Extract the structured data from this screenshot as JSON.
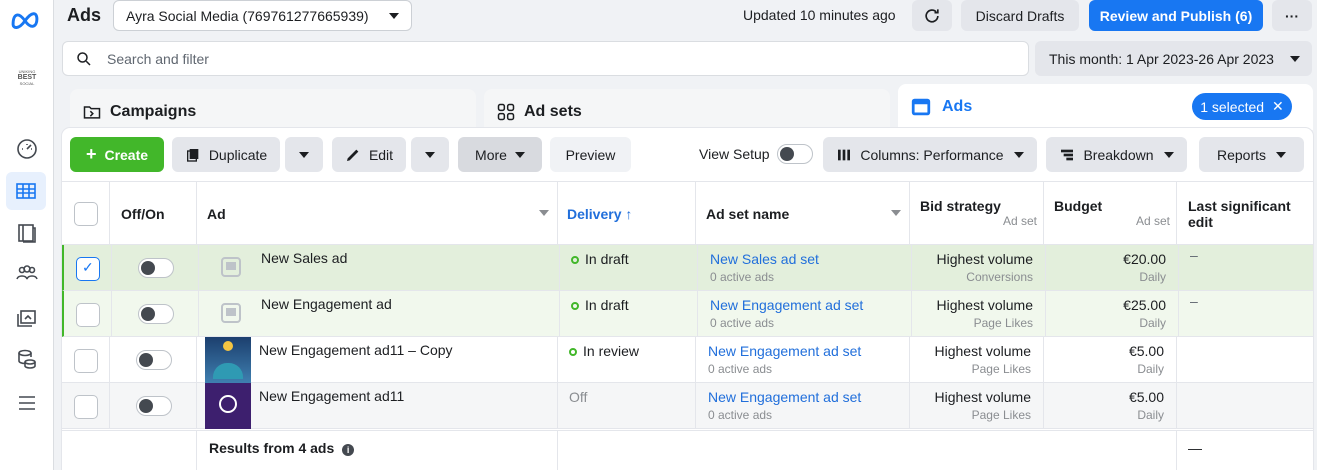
{
  "header": {
    "title": "Ads",
    "account": "Ayra Social Media (769761277665939)",
    "updated": "Updated 10 minutes ago",
    "discard_label": "Discard Drafts",
    "publish_label": "Review and Publish (6)",
    "more_dots": "···"
  },
  "search": {
    "placeholder": "Search and filter"
  },
  "date_range": "This month: 1 Apr 2023-26 Apr 2023",
  "tabs": {
    "campaigns": "Campaigns",
    "adsets": "Ad sets",
    "ads": "Ads",
    "selected": "1 selected"
  },
  "toolbar": {
    "create": "Create",
    "duplicate": "Duplicate",
    "edit": "Edit",
    "more": "More",
    "preview": "Preview",
    "view_setup": "View Setup",
    "columns": "Columns: Performance",
    "breakdown": "Breakdown",
    "reports": "Reports"
  },
  "columns": {
    "offon": "Off/On",
    "ad": "Ad",
    "delivery": "Delivery",
    "adset": "Ad set name",
    "bid": "Bid strategy",
    "bid_sub": "Ad set",
    "budget": "Budget",
    "budget_sub": "Ad set",
    "last_edit": "Last significant edit"
  },
  "rows": [
    {
      "name": "New Sales ad",
      "delivery": "In draft",
      "delivery_active": true,
      "adset": "New Sales ad set",
      "adset_sub": "0 active ads",
      "bid": "Highest volume",
      "bid_sub": "Conversions",
      "budget": "€20.00",
      "budget_sub": "Daily",
      "last_edit": "–",
      "thumb": "placeholder-icon"
    },
    {
      "name": "New Engagement ad",
      "delivery": "In draft",
      "delivery_active": true,
      "adset": "New Engagement ad set",
      "adset_sub": "0 active ads",
      "bid": "Highest volume",
      "bid_sub": "Page Likes",
      "budget": "€25.00",
      "budget_sub": "Daily",
      "last_edit": "–",
      "thumb": "placeholder-icon"
    },
    {
      "name": "New Engagement ad11 – Copy",
      "delivery": "In review",
      "delivery_active": true,
      "adset": "New Engagement ad set",
      "adset_sub": "0 active ads",
      "bid": "Highest volume",
      "bid_sub": "Page Likes",
      "budget": "€5.00",
      "budget_sub": "Daily",
      "last_edit": "",
      "thumb": "mosque-image"
    },
    {
      "name": "New Engagement ad11",
      "delivery": "Off",
      "delivery_active": false,
      "adset": "New Engagement ad set",
      "adset_sub": "0 active ads",
      "bid": "Highest volume",
      "bid_sub": "Page Likes",
      "budget": "€5.00",
      "budget_sub": "Daily",
      "last_edit": "",
      "thumb": "purple-logo-image"
    }
  ],
  "footer": {
    "results": "Results from 4 ads",
    "last_edit": "—"
  },
  "colors": {
    "accent": "#1877f2",
    "create": "#42b72a",
    "selected_row": "#e3efdc"
  }
}
